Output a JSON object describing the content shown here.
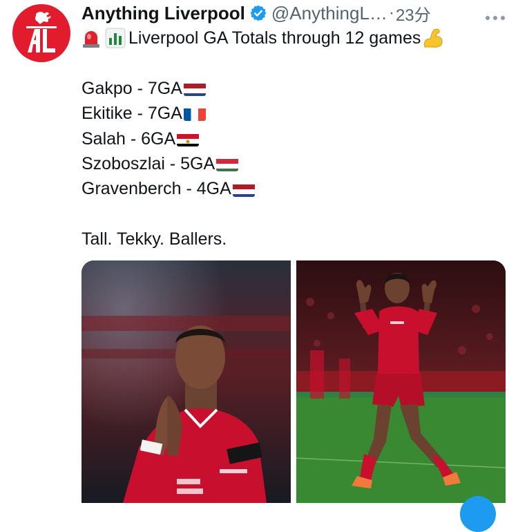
{
  "author": {
    "name": "Anything Liverpool",
    "handle": "@AnythingL…",
    "separator": "·",
    "time": "23分",
    "verified": true,
    "avatar_text": "AL",
    "avatar_color": "#e21c2c"
  },
  "icons": {
    "more": "more-options-icon",
    "verified": "verified-badge-icon"
  },
  "tweet": {
    "headline": "Liverpool GA Totals through 12 games",
    "players": [
      {
        "text": "Gakpo - 7GA",
        "flag": "netherlands"
      },
      {
        "text": "Ekitike - 7GA",
        "flag": "france"
      },
      {
        "text": "Salah - 6GA",
        "flag": "egypt"
      },
      {
        "text": "Szoboszlai - 5GA",
        "flag": "hungary"
      },
      {
        "text": "Gravenberch - 4GA",
        "flag": "netherlands"
      }
    ],
    "closing": "Tall. Tekky. Ballers."
  },
  "media": {
    "photos": [
      {
        "name": "player-praying-photo"
      },
      {
        "name": "player-celebrating-photo"
      }
    ]
  },
  "colors": {
    "accent": "#1d9bf0",
    "text": "#0f1419",
    "muted": "#536471",
    "kit_red": "#c8102e"
  }
}
